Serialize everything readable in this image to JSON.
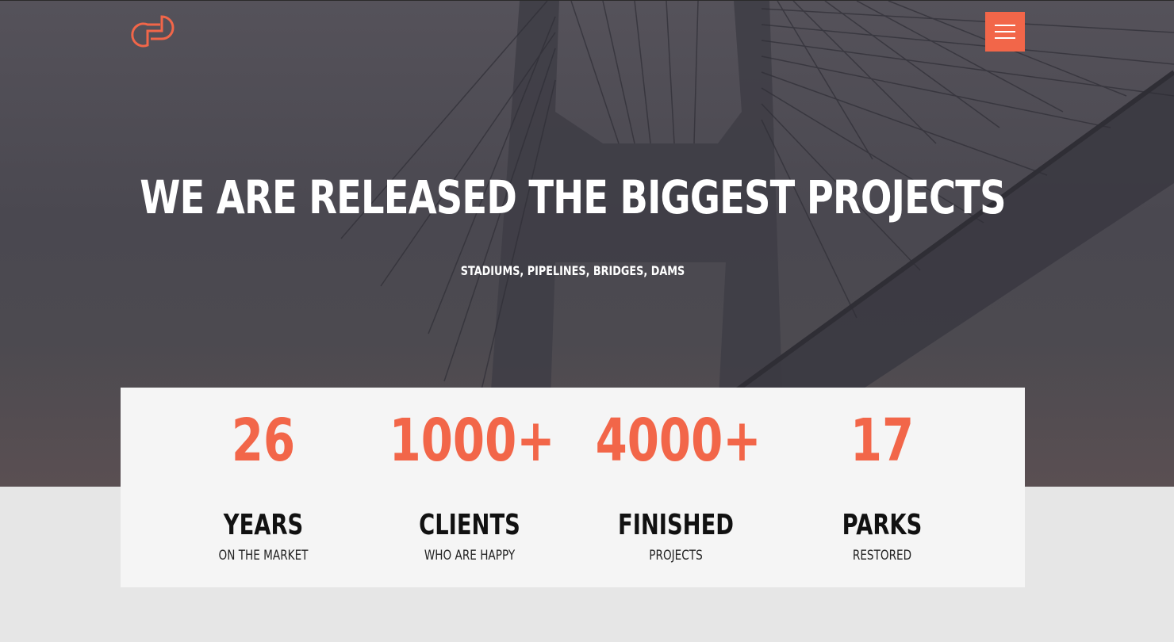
{
  "header": {
    "logo_icon": "linked-squares-logo-icon",
    "menu_icon": "hamburger-menu-icon"
  },
  "hero": {
    "headline": "WE ARE RELEASED THE BIGGEST PROJECTS",
    "subline": "STADIUMS, PIPELINES, BRIDGES, DAMS"
  },
  "stats": [
    {
      "number": "26",
      "label": "YEARS",
      "sub": "ON THE MARKET"
    },
    {
      "number": "1000+",
      "label": "CLIENTS",
      "sub": "WHO ARE HAPPY"
    },
    {
      "number": "4000+",
      "label": "FINISHED",
      "sub": "PROJECTS"
    },
    {
      "number": "17",
      "label": "PARKS",
      "sub": "RESTORED"
    }
  ],
  "colors": {
    "accent": "#f26649",
    "hero_overlay": "#4c4a52",
    "panel": "#f5f5f5",
    "page_bg": "#e6e6e6"
  }
}
